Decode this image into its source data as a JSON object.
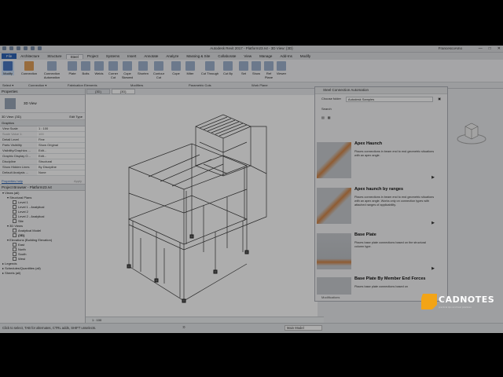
{
  "window": {
    "title": "Autodesk Revit 2017 - Platform23.rvt - 3D View: {3D}",
    "user": "FrancescoAmo"
  },
  "menu": {
    "file": "File",
    "tabs": [
      "Architecture",
      "Structure",
      "Steel",
      "Project",
      "Systems",
      "Insert",
      "Annotate",
      "Analyze",
      "Massing & Site",
      "Collaborate",
      "View",
      "Manage",
      "Add-Ins",
      "Modify"
    ],
    "active_tab": "Steel"
  },
  "ribbon": {
    "buttons": [
      {
        "label": "Modify",
        "selected": true
      },
      {
        "label": "Connection"
      },
      {
        "label": "Connection Automation"
      },
      {
        "label": "Plate"
      },
      {
        "label": "Bolts"
      },
      {
        "label": "Welds"
      },
      {
        "label": "Corner Cut"
      },
      {
        "label": "Cope Skewed"
      },
      {
        "label": "Shorten"
      },
      {
        "label": "Contour Cut"
      },
      {
        "label": "Cope"
      },
      {
        "label": "Miter"
      },
      {
        "label": "Cut Through"
      },
      {
        "label": "Cut By"
      },
      {
        "label": "Set"
      },
      {
        "label": "Show"
      },
      {
        "label": "Ref Plane"
      },
      {
        "label": "Viewer"
      }
    ],
    "groups": [
      "Select ▾",
      "Connection ▾",
      "Fabrication Elements",
      "Modifiers",
      "Parametric Cuts",
      "Work Plane"
    ]
  },
  "properties": {
    "header": "Properties",
    "type_name": "3D View",
    "selector": "3D View: {3D}",
    "edit_type": "Edit Type",
    "section": "Graphics",
    "rows": [
      {
        "k": "View Scale",
        "v": "1 : 100"
      },
      {
        "k": "Scale Value 1:",
        "v": "100"
      },
      {
        "k": "Detail Level",
        "v": "Fine"
      },
      {
        "k": "Parts Visibility",
        "v": "Show Original"
      },
      {
        "k": "Visibility/Graphics ...",
        "v": "Edit..."
      },
      {
        "k": "Graphic Display O...",
        "v": "Edit..."
      },
      {
        "k": "Discipline",
        "v": "Structural"
      },
      {
        "k": "Show Hidden Lines",
        "v": "By Discipline"
      },
      {
        "k": "Default Analysis ...",
        "v": "None"
      }
    ],
    "help": "Properties help",
    "apply": "Apply"
  },
  "project_browser": {
    "header": "Project Browser - Platform23.rvt",
    "items": [
      {
        "label": "Views (all)",
        "lvl": 0
      },
      {
        "label": "Structural Plans",
        "lvl": 1
      },
      {
        "label": "Level 1",
        "lvl": 2
      },
      {
        "label": "Level 1 - Analytical",
        "lvl": 2
      },
      {
        "label": "Level 2",
        "lvl": 2
      },
      {
        "label": "Level 2 - Analytical",
        "lvl": 2
      },
      {
        "label": "Site",
        "lvl": 2
      },
      {
        "label": "3D Views",
        "lvl": 1
      },
      {
        "label": "Analytical Model",
        "lvl": 2
      },
      {
        "label": "{3D}",
        "lvl": 2
      },
      {
        "label": "Elevations (Building Elevation)",
        "lvl": 1
      },
      {
        "label": "East",
        "lvl": 2
      },
      {
        "label": "North",
        "lvl": 2
      },
      {
        "label": "South",
        "lvl": 2
      },
      {
        "label": "West",
        "lvl": 2
      },
      {
        "label": "Legends",
        "lvl": 0
      },
      {
        "label": "Schedules/Quantities (all)",
        "lvl": 0
      },
      {
        "label": "Sheets (all)",
        "lvl": 0
      }
    ]
  },
  "view_tabs": [
    "{3D}",
    "{3D}"
  ],
  "view_status": "1 : 100",
  "connection_browser": {
    "title": "Steel Connection Automation",
    "choose_folder_label": "Choose folder",
    "folder_value": "Autodesk Samples",
    "search_label": "Search",
    "cards": [
      {
        "name": "Apex Haunch",
        "desc": "Places connections in beam end to end geometric situations with an apex angle."
      },
      {
        "name": "Apex haunch by ranges",
        "desc": "Places connections in beam end to end geometric situations with an apex angle. Works only on connection types with attached ranges of applicability."
      },
      {
        "name": "Base Plate",
        "desc": "Places base plate connections based on the structural column type."
      },
      {
        "name": "Base Plate By Member End Forces",
        "desc": "Places base plate connections based on"
      }
    ],
    "footer": "Modifications"
  },
  "status": {
    "hint": "Click to select, TAB for alternates, CTRL adds, SHIFT unselects.",
    "model": "Main Model",
    "zero": ":0"
  },
  "logo": {
    "name": "CADNOTES",
    "tagline": "practical tips and best practices"
  }
}
